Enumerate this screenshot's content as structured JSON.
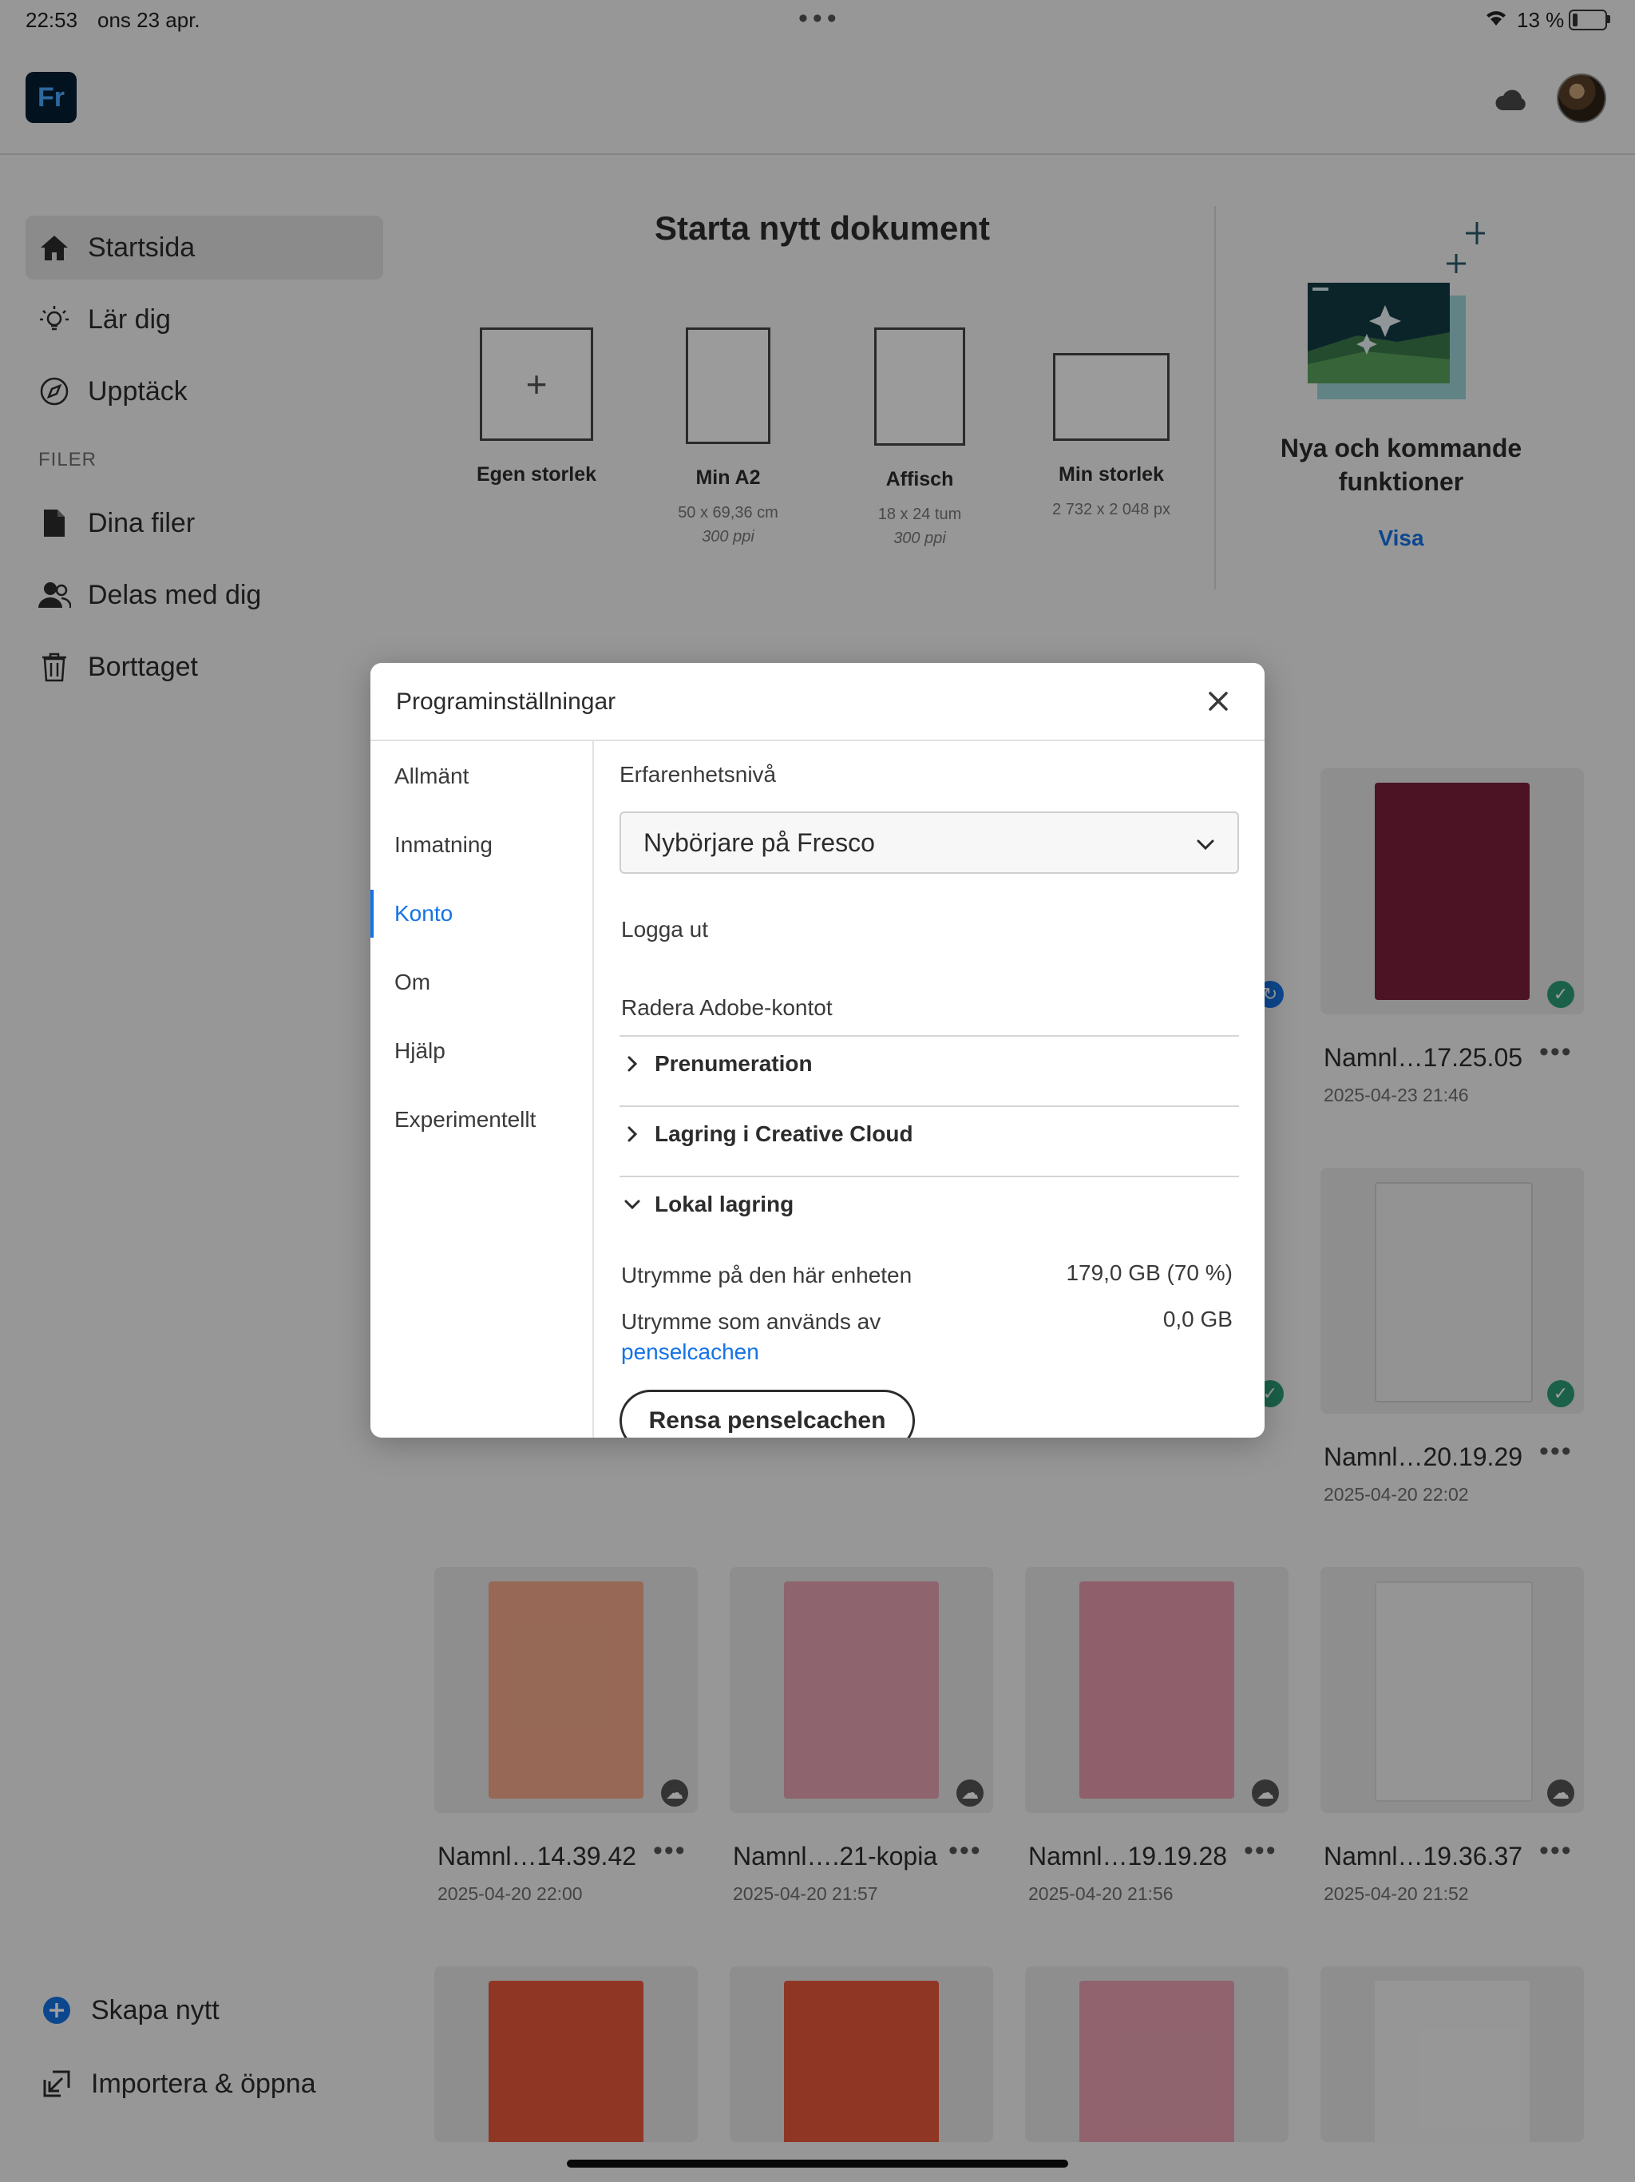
{
  "status_bar": {
    "time": "22:53",
    "date": "ons 23 apr.",
    "dots": "•••",
    "battery": "13 %"
  },
  "app": {
    "logo": "Fr"
  },
  "sidebar": {
    "items": [
      {
        "label": "Startsida",
        "icon": "home-icon"
      },
      {
        "label": "Lär dig",
        "icon": "lightbulb-icon"
      },
      {
        "label": "Upptäck",
        "icon": "compass-icon"
      }
    ],
    "section_files": "FILER",
    "file_items": [
      {
        "label": "Dina filer",
        "icon": "file-icon"
      },
      {
        "label": "Delas med dig",
        "icon": "shared-user-icon"
      },
      {
        "label": "Borttaget",
        "icon": "trash-icon"
      }
    ],
    "bottom": [
      {
        "label": "Skapa nytt",
        "icon": "plus-circle-icon"
      },
      {
        "label": "Importera & öppna",
        "icon": "import-icon"
      }
    ]
  },
  "new_document": {
    "title": "Starta nytt dokument",
    "presets": [
      {
        "name": "Egen storlek",
        "line1": "",
        "line2": ""
      },
      {
        "name": "Min A2",
        "line1": "50 x 69,36 cm",
        "line2": "300 ppi"
      },
      {
        "name": "Affisch",
        "line1": "18 x 24 tum",
        "line2": "300 ppi"
      },
      {
        "name": "Min storlek",
        "line1": "2 732 x 2 048 px",
        "line2": ""
      }
    ]
  },
  "whats_new": {
    "title": "Nya och kommande funktioner",
    "link": "Visa"
  },
  "files": [
    {
      "name": "Namnl…17.25.05",
      "date": "2025-04-23 21:46",
      "status": "synced"
    },
    {
      "name": "Namnl…20.19.29",
      "date": "2025-04-20 22:02",
      "status": "synced"
    },
    {
      "name": "Namnl…14.39.42",
      "date": "2025-04-20 22:00",
      "status": "cloud"
    },
    {
      "name": "Namnl….21-kopia",
      "date": "2025-04-20 21:57",
      "status": "cloud"
    },
    {
      "name": "Namnl…19.19.28",
      "date": "2025-04-20 21:56",
      "status": "cloud"
    },
    {
      "name": "Namnl…19.36.37",
      "date": "2025-04-20 21:52",
      "status": "cloud"
    }
  ],
  "card_more": "•••",
  "modal": {
    "title": "Programinställningar",
    "nav": [
      "Allmänt",
      "Inmatning",
      "Konto",
      "Om",
      "Hjälp",
      "Experimentellt"
    ],
    "active_nav": "Konto",
    "experience_label": "Erfarenhetsnivå",
    "experience_value": "Nybörjare på Fresco",
    "logout": "Logga ut",
    "delete_account": "Radera Adobe-kontot",
    "sections": {
      "subscription": "Prenumeration",
      "cc_storage": "Lagring i Creative Cloud",
      "local_storage": "Lokal lagring"
    },
    "device_space_label": "Utrymme på den här enheten",
    "device_space_value": "179,0 GB (70 %)",
    "brush_cache_label": "Utrymme som används av",
    "brush_cache_link": "penselcachen",
    "brush_cache_value": "0,0 GB",
    "clear_button": "Rensa penselcachen"
  },
  "colors": {
    "accent": "#1473e6",
    "sync_green": "#2d9d78",
    "logo_bg": "#061e33",
    "logo_fg": "#47a9ff"
  }
}
